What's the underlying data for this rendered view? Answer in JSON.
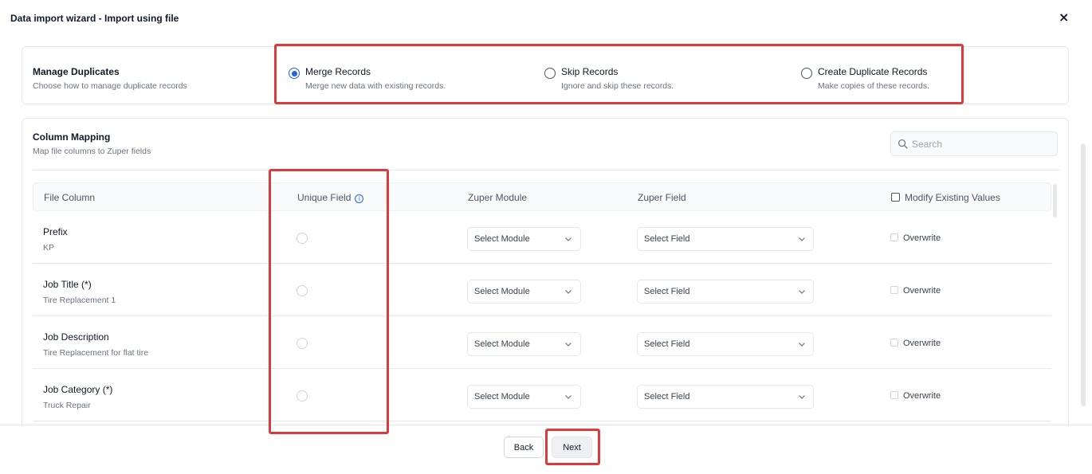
{
  "header": {
    "title": "Data import wizard - Import using file",
    "close_glyph": "×"
  },
  "duplicates": {
    "title": "Manage Duplicates",
    "subtitle": "Choose how to manage duplicate records",
    "options": [
      {
        "label": "Merge Records",
        "description": "Merge new data with existing records.",
        "selected": true
      },
      {
        "label": "Skip Records",
        "description": "Ignore and skip these records.",
        "selected": false
      },
      {
        "label": "Create Duplicate Records",
        "description": "Make copies of these records.",
        "selected": false
      }
    ]
  },
  "mapping": {
    "title": "Column Mapping",
    "subtitle": "Map file columns to Zuper fields",
    "search_placeholder": "Search",
    "columns": {
      "file_column": "File Column",
      "unique_field": "Unique Field",
      "zuper_module": "Zuper Module",
      "zuper_field": "Zuper Field",
      "modify_existing": "Modify Existing Values"
    },
    "rows": [
      {
        "name": "Prefix",
        "sample": "KP",
        "module": "Select Module",
        "field": "Select Field",
        "overwrite": "Overwrite"
      },
      {
        "name": "Job Title (*)",
        "sample": "Tire Replacement 1",
        "module": "Select Module",
        "field": "Select Field",
        "overwrite": "Overwrite"
      },
      {
        "name": "Job Description",
        "sample": "Tire Replacement for flat tire",
        "module": "Select Module",
        "field": "Select Field",
        "overwrite": "Overwrite"
      },
      {
        "name": "Job Category (*)",
        "sample": "Truck Repair",
        "module": "Select Module",
        "field": "Select Field",
        "overwrite": "Overwrite"
      }
    ]
  },
  "footer": {
    "back_label": "Back",
    "next_label": "Next"
  },
  "colors": {
    "accent": "#2563eb",
    "highlight": "#dc3b3b"
  }
}
